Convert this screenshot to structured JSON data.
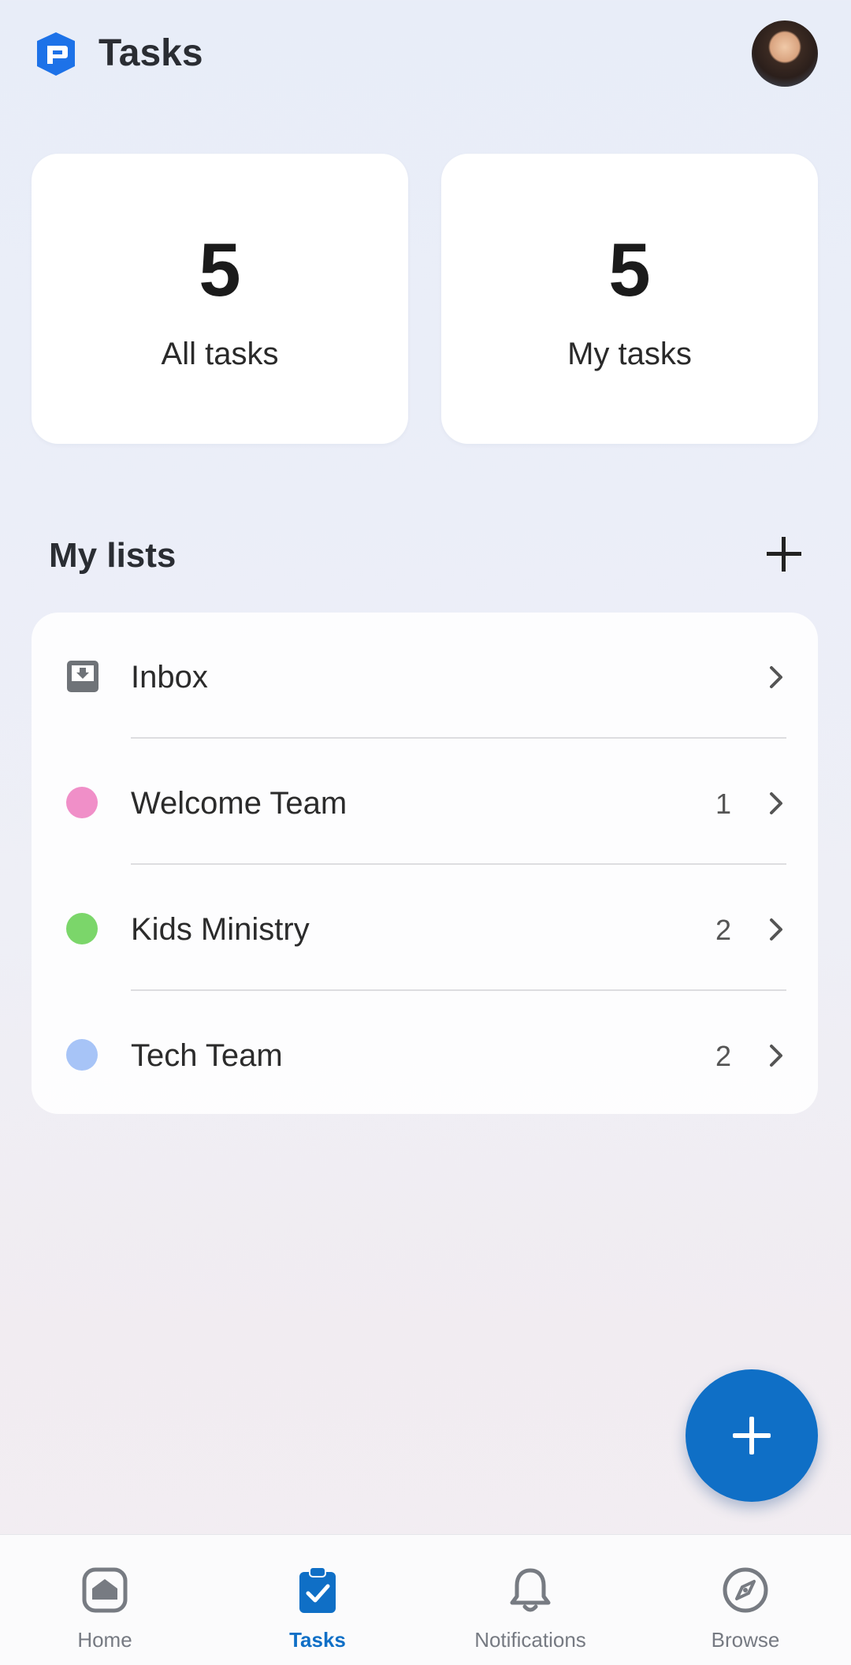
{
  "header": {
    "title": "Tasks",
    "logo_icon": "planning-center-logo-icon",
    "avatar": "user-avatar"
  },
  "stats": [
    {
      "count": "5",
      "label": "All tasks"
    },
    {
      "count": "5",
      "label": "My tasks"
    }
  ],
  "lists_section": {
    "title": "My lists",
    "add_icon": "plus-icon",
    "items": [
      {
        "label": "Inbox",
        "count": "",
        "icon": "inbox-tray-icon"
      },
      {
        "label": "Welcome Team",
        "count": "1",
        "color": "#f08fc8"
      },
      {
        "label": "Kids Ministry",
        "count": "2",
        "color": "#7bd66a"
      },
      {
        "label": "Tech Team",
        "count": "2",
        "color": "#a7c4f7"
      }
    ]
  },
  "fab": {
    "icon": "plus-icon"
  },
  "bottom_nav": {
    "accent": "#0f6fc6",
    "items": [
      {
        "label": "Home",
        "icon": "home-icon"
      },
      {
        "label": "Tasks",
        "icon": "clipboard-check-icon",
        "active": true
      },
      {
        "label": "Notifications",
        "icon": "bell-icon"
      },
      {
        "label": "Browse",
        "icon": "compass-icon"
      }
    ]
  }
}
